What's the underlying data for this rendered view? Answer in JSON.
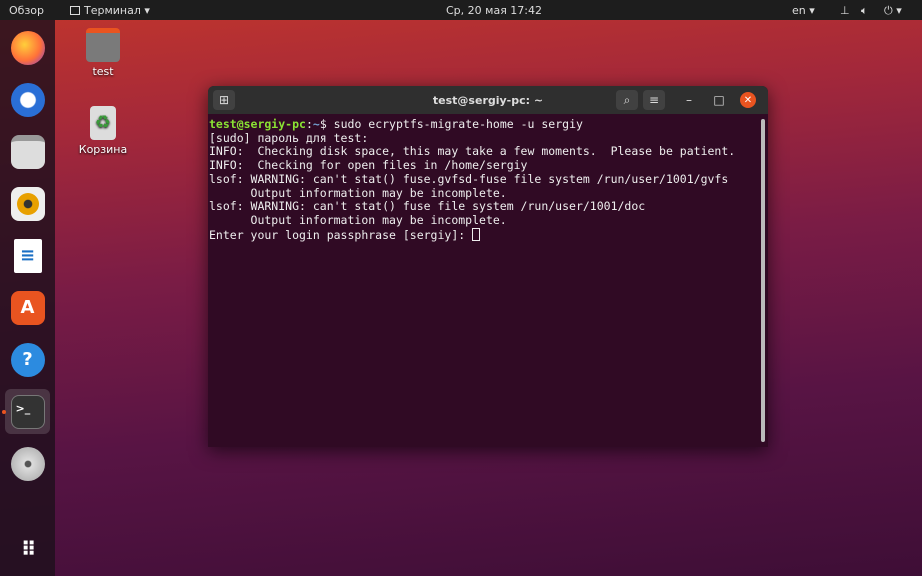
{
  "topbar": {
    "overview": "Обзор",
    "app_menu": "Терминал",
    "clock": "Ср, 20 мая  17:42",
    "lang": "en"
  },
  "dock": {
    "items": [
      "Firefox",
      "Thunderbird",
      "Files",
      "Rhythmbox",
      "LibreOffice Writer",
      "Ubuntu Software",
      "Help",
      "Terminal",
      "Disc"
    ],
    "apps_grid": "Show Applications"
  },
  "desktop": {
    "icons": [
      {
        "label": "test"
      },
      {
        "label": "Корзина"
      }
    ]
  },
  "terminal": {
    "title": "test@sergiy-pc: ~",
    "prompt_user": "test@sergiy-pc",
    "prompt_sep": ":",
    "prompt_path": "~",
    "prompt_sign": "$ ",
    "command": "sudo ecryptfs-migrate-home -u sergiy",
    "lines": [
      "[sudo] пароль для test:",
      "INFO:  Checking disk space, this may take a few moments.  Please be patient.",
      "INFO:  Checking for open files in /home/sergiy",
      "lsof: WARNING: can't stat() fuse.gvfsd-fuse file system /run/user/1001/gvfs",
      "      Output information may be incomplete.",
      "lsof: WARNING: can't stat() fuse file system /run/user/1001/doc",
      "      Output information may be incomplete."
    ],
    "last_prompt": "Enter your login passphrase [sergiy]: "
  }
}
